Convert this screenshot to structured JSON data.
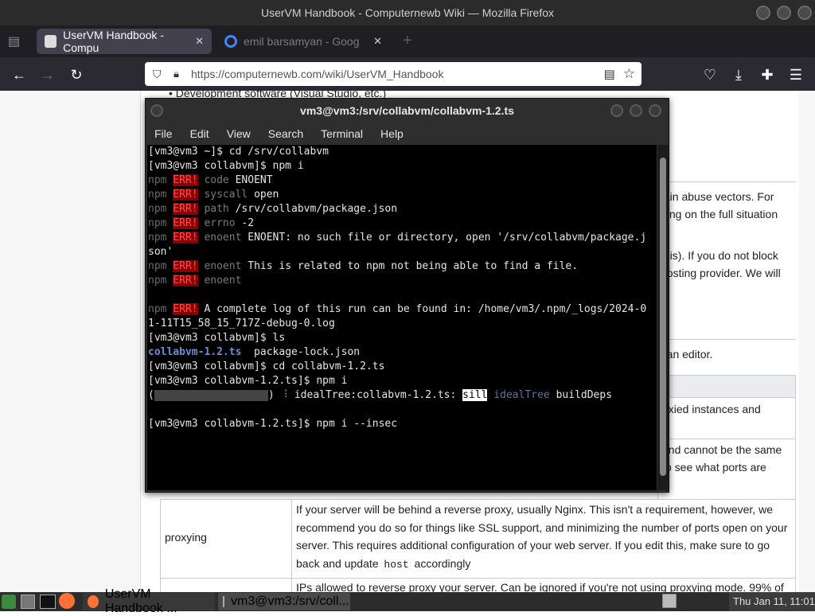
{
  "window_title": "UserVM Handbook - Computernewb Wiki — Mozilla Firefox",
  "tabs": [
    {
      "label": "UserVM Handbook - Compu",
      "close": "✕"
    },
    {
      "label": "emil barsamyan - Goog",
      "close": "✕"
    }
  ],
  "new_tab": "+",
  "url": "https://computernewb.com/wiki/UserVM_Handbook",
  "page": {
    "bullet": "Development software (Visual Studio, etc.)",
    "right_text": [
      "tain abuse vectors. For",
      "ding on the full situation",
      "this). If you do not block",
      "hosting provider. We will",
      "n an editor.",
      "oxied instances and",
      "and cannot be the same",
      "o see what ports are"
    ],
    "proxy_row": {
      "key": "proxying",
      "desc_lines": [
        "If your server will be behind a reverse proxy, usually Nginx. This isn't a requirement, however, we",
        "recommend you do so for things like SSL support, and minimizing the number of ports open on your",
        "server. This requires additional configuration of your web server. If you edit this, make sure to go"
      ],
      "desc_last_pre": "back and update",
      "desc_code": "host",
      "desc_last_post": "accordingly"
    },
    "next_row_text": "IPs allowed to reverse proxy your server. Can be ignored if you're not using proxying mode. 99% of"
  },
  "terminal": {
    "title": "vm3@vm3:/srv/collabvm/collabvm-1.2.ts",
    "menu": [
      "File",
      "Edit",
      "View",
      "Search",
      "Terminal",
      "Help"
    ],
    "lines": {
      "l1": "[vm3@vm3 ~]$ cd /srv/collabvm",
      "l2": "[vm3@vm3 collabvm]$ npm i",
      "npm": "npm",
      "err": "ERR!",
      "e1_key": "code",
      "e1_val": " ENOENT",
      "e2_key": "syscall",
      "e2_val": " open",
      "e3_key": "path",
      "e3_val": " /srv/collabvm/package.json",
      "e4_key": "errno",
      "e4_val": " -2",
      "e5_key": "enoent",
      "e5_val": " ENOENT: no such file or directory, open '/srv/collabvm/package.j",
      "e5_wrap": "son'",
      "e6_key": "enoent",
      "e6_val": " This is related to npm not being able to find a file.",
      "e7_key": "enoent",
      "log1": " A complete log of this run can be found in: /home/vm3/.npm/_logs/2024-0",
      "log2": "1-11T15_58_15_717Z-debug-0.log",
      "ls_cmd": "[vm3@vm3 collabvm]$ ls",
      "ls_dir": "collabvm-1.2.ts",
      "ls_file": "  package-lock.json",
      "cd2": "[vm3@vm3 collabvm]$ cd collabvm-1.2.ts",
      "npmi": "[vm3@vm3 collabvm-1.2.ts]$ npm i",
      "prog_open": "(",
      "prog_close": ") ",
      "prog_spin": "⠸",
      "prog_text": " idealTree:collabvm-1.2.ts: ",
      "prog_sill": "sill",
      "prog_ideal": " idealTree",
      "prog_build": " buildDeps",
      "last": "[vm3@vm3 collabvm-1.2.ts]$ npm i --insec"
    }
  },
  "taskbar": {
    "app1": "UserVM Handbook ...",
    "app2": "vm3@vm3:/srv/coll...",
    "clock": "Thu Jan 11, 11:01"
  }
}
